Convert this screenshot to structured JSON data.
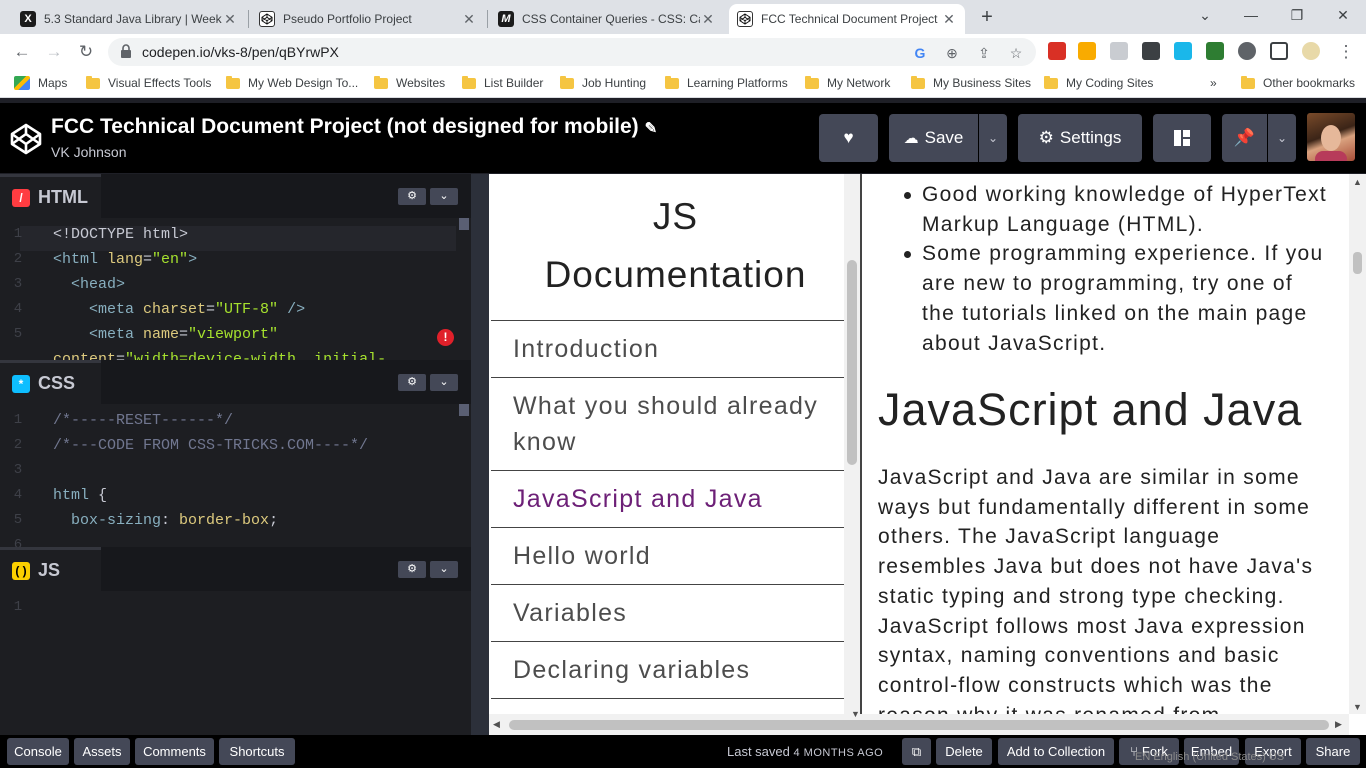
{
  "browser": {
    "tabs": [
      {
        "title": "5.3 Standard Java Library | Week",
        "favicon": "X",
        "active": false
      },
      {
        "title": "Pseudo Portfolio Project",
        "favicon": "codepen",
        "active": false
      },
      {
        "title": "CSS Container Queries - CSS: Cas",
        "favicon": "M",
        "active": false
      },
      {
        "title": "FCC Technical Document Project",
        "favicon": "codepen",
        "active": true
      }
    ],
    "url": "codepen.io/vks-8/pen/qBYrwPX",
    "bookmarks": [
      "Maps",
      "Visual Effects Tools",
      "My Web Design To...",
      "Websites",
      "List Builder",
      "Job Hunting",
      "Learning Platforms",
      "My Network",
      "My Business Sites",
      "My Coding Sites"
    ],
    "other_bookmarks": "Other bookmarks",
    "more": "»"
  },
  "header": {
    "title": "FCC Technical Document Project (not designed for mobile)",
    "author": "VK Johnson",
    "save_label": "Save",
    "settings_label": "Settings"
  },
  "editors": {
    "html": {
      "label": "HTML",
      "lines": [
        {
          "n": "1",
          "parts": [
            [
              "doc",
              "<!DOCTYPE html>"
            ]
          ]
        },
        {
          "n": "2",
          "parts": [
            [
              "tag",
              "<html "
            ],
            [
              "attr",
              "lang"
            ],
            [
              "txt",
              "="
            ],
            [
              "str",
              "\"en\""
            ],
            [
              "tag",
              ">"
            ]
          ]
        },
        {
          "n": "3",
          "parts": [
            [
              "tag",
              "  <head>"
            ]
          ]
        },
        {
          "n": "4",
          "parts": [
            [
              "tag",
              "    <meta "
            ],
            [
              "attr",
              "charset"
            ],
            [
              "txt",
              "="
            ],
            [
              "str",
              "\"UTF-8\""
            ],
            [
              "tag",
              " />"
            ]
          ]
        },
        {
          "n": "5",
          "parts": [
            [
              "tag",
              "    <meta "
            ],
            [
              "attr",
              "name"
            ],
            [
              "txt",
              "="
            ],
            [
              "str",
              "\"viewport\""
            ]
          ]
        },
        {
          "n": "",
          "parts": [
            [
              "attr",
              "content"
            ],
            [
              "txt",
              "="
            ],
            [
              "str",
              "\"width=device-width, initial-"
            ]
          ]
        }
      ]
    },
    "css": {
      "label": "CSS",
      "lines": [
        {
          "n": "1",
          "parts": [
            [
              "com",
              "/*-----RESET------*/"
            ]
          ]
        },
        {
          "n": "2",
          "parts": [
            [
              "com",
              "/*---CODE FROM CSS-TRICKS.COM----*/"
            ]
          ]
        },
        {
          "n": "3",
          "parts": []
        },
        {
          "n": "4",
          "parts": [
            [
              "prop",
              "html "
            ],
            [
              "txt",
              "{"
            ]
          ]
        },
        {
          "n": "5",
          "parts": [
            [
              "prop",
              "  box-sizing"
            ],
            [
              "txt",
              ": "
            ],
            [
              "val",
              "border-box"
            ],
            [
              "txt",
              ";"
            ]
          ]
        },
        {
          "n": "6",
          "parts": []
        }
      ]
    },
    "js": {
      "label": "JS",
      "lines": [
        {
          "n": "1",
          "parts": []
        }
      ]
    }
  },
  "preview": {
    "nav_title": "JS Documentation",
    "nav_links": [
      {
        "label": "Introduction",
        "visited": false
      },
      {
        "label": "What you should already know",
        "visited": false
      },
      {
        "label": "JavaScript and Java",
        "visited": true
      },
      {
        "label": "Hello world",
        "visited": false
      },
      {
        "label": "Variables",
        "visited": false
      },
      {
        "label": "Declaring variables",
        "visited": false
      }
    ],
    "bullets": [
      "Good working knowledge of HyperText Markup Language (HTML).",
      "Some programming experience. If you are new to programming, try one of the tutorials linked on the main page about JavaScript."
    ],
    "section_heading": "JavaScript and Java",
    "section_text": "JavaScript and Java are similar in some ways but fundamentally different in some others. The JavaScript language resembles Java but does not have Java's static typing and strong type checking. JavaScript follows most Java expression syntax, naming conventions and basic control-flow constructs which was the reason why it was renamed from"
  },
  "footer": {
    "left_buttons": [
      "Console",
      "Assets",
      "Comments",
      "Shortcuts"
    ],
    "last_saved_label": "Last saved",
    "last_saved_ago": "4 MONTHS AGO",
    "right_buttons": [
      "Delete",
      "Add to Collection",
      "Fork",
      "Embed",
      "Export",
      "Share"
    ],
    "ime": "EN English (United States)     US"
  },
  "colors": {
    "visited_link": "#6d2077",
    "codepen_bg": "#000000",
    "button_bg": "#444857"
  }
}
